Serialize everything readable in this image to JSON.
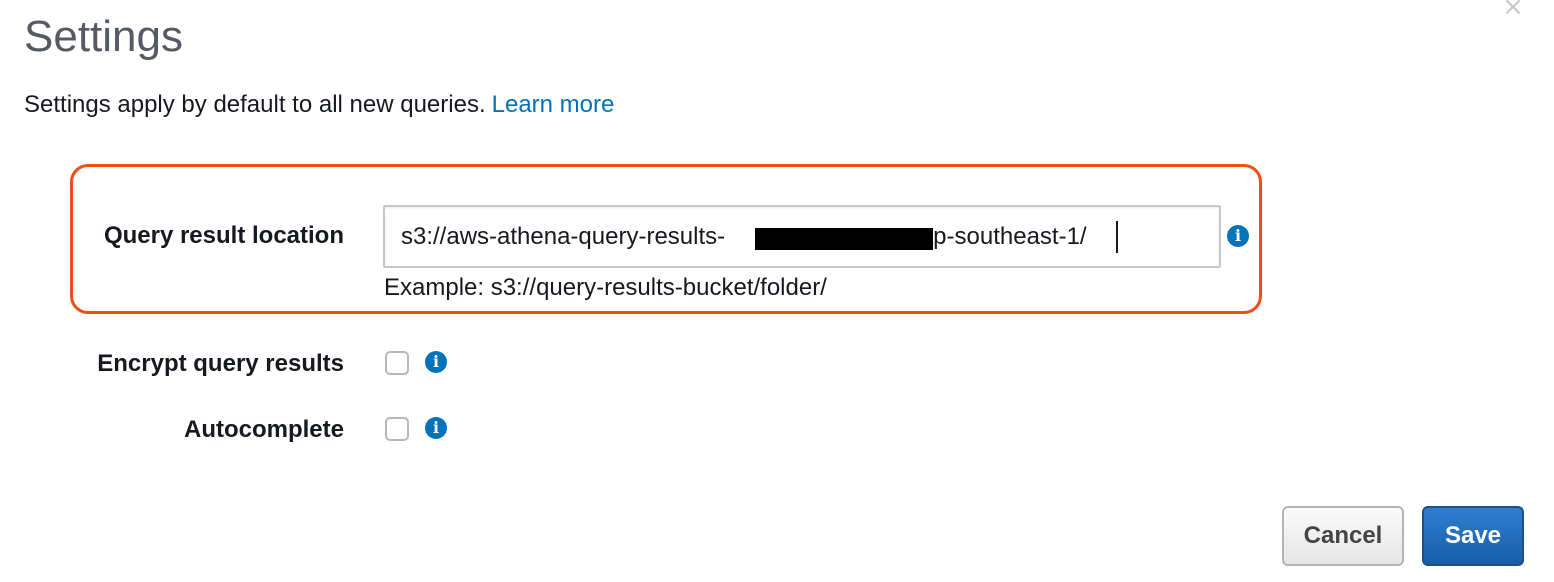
{
  "dialog": {
    "title": "Settings",
    "close_icon": "close-icon",
    "close_glyph": "×",
    "description": "Settings apply by default to all new queries.",
    "learn_more_link": "Learn more"
  },
  "fields": {
    "query_result_location": {
      "label": "Query result location",
      "value": "s3://aws-athena-query-results-                            -ap-southeast-1/",
      "value_redacted": true,
      "hint": "Example: s3://query-results-bucket/folder/",
      "highlighted": true,
      "highlight_color": "#eb4f17",
      "info_icon": "info-icon"
    },
    "encrypt_query_results": {
      "label": "Encrypt query results",
      "checked": false,
      "info_icon": "info-icon"
    },
    "autocomplete": {
      "label": "Autocomplete",
      "checked": false,
      "info_icon": "info-icon"
    }
  },
  "icons": {
    "info_glyph": "i"
  },
  "footer": {
    "cancel_label": "Cancel",
    "save_label": "Save"
  },
  "colors": {
    "link": "#0073bb",
    "primary_button": "#1f6fc0",
    "info_icon": "#0073bb",
    "highlight": "#eb4f17"
  }
}
